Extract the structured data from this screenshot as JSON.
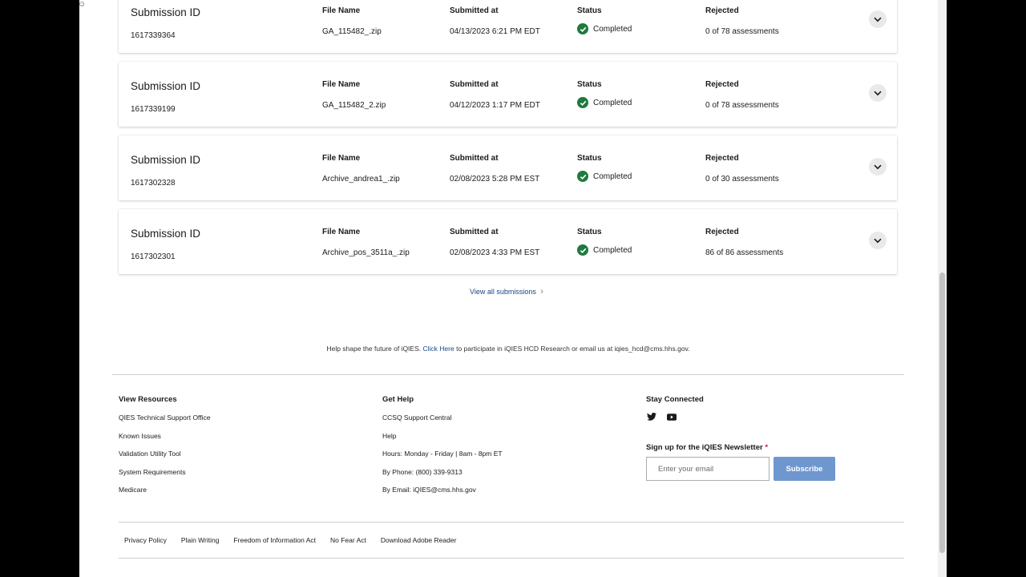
{
  "submissions": [
    {
      "label": "Submission ID",
      "id": "1617339364",
      "file_header": "File Name",
      "file": "GA_115482_.zip",
      "date_header": "Submitted at",
      "date": "04/13/2023 6:21 PM EDT",
      "status_header": "Status",
      "status": "Completed",
      "rejected_header": "Rejected",
      "rejected": "0 of 78 assessments"
    },
    {
      "label": "Submission ID",
      "id": "1617339199",
      "file_header": "File Name",
      "file": "GA_115482_2.zip",
      "date_header": "Submitted at",
      "date": "04/12/2023 1:17 PM EDT",
      "status_header": "Status",
      "status": "Completed",
      "rejected_header": "Rejected",
      "rejected": "0 of 78 assessments"
    },
    {
      "label": "Submission ID",
      "id": "1617302328",
      "file_header": "File Name",
      "file": "Archive_andrea1_.zip",
      "date_header": "Submitted at",
      "date": "02/08/2023 5:28 PM EST",
      "status_header": "Status",
      "status": "Completed",
      "rejected_header": "Rejected",
      "rejected": "0 of 30 assessments"
    },
    {
      "label": "Submission ID",
      "id": "1617302301",
      "file_header": "File Name",
      "file": "Archive_pos_3511a_.zip",
      "date_header": "Submitted at",
      "date": "02/08/2023 4:33 PM EST",
      "status_header": "Status",
      "status": "Completed",
      "rejected_header": "Rejected",
      "rejected": "86 of 86 assessments"
    }
  ],
  "view_all": "View all submissions",
  "help": {
    "before": "Help shape the future of iQIES.",
    "link": "Click Here",
    "after": "to participate in iQIES HCD Research or email us at iqies_hcd@cms.hhs.gov."
  },
  "footer": {
    "resources": {
      "title": "View Resources",
      "items": [
        "QIES Technical Support Office",
        "Known Issues",
        "Validation Utility Tool",
        "System Requirements",
        "Medicare"
      ]
    },
    "get_help": {
      "title": "Get Help",
      "items": [
        "CCSQ Support Central",
        "Help",
        "Hours: Monday - Friday | 8am - 8pm ET",
        "By Phone: (800) 339-9313",
        "By Email: iQIES@cms.hhs.gov"
      ]
    },
    "stay_connected": {
      "title": "Stay Connected",
      "icons": [
        "twitter-icon",
        "youtube-icon"
      ]
    },
    "newsletter": {
      "label": "Sign up for the iQIES Newsletter",
      "required": "*",
      "placeholder": "Enter your email",
      "button": "Subscribe"
    },
    "legal": [
      "Privacy Policy",
      "Plain Writing",
      "Freedom of Information Act",
      "No Fear Act",
      "Download Adobe Reader"
    ]
  },
  "colors": {
    "check": "#1f7a3d",
    "rejected_alert": "#c0235c",
    "link": "#1a4480",
    "subscribe": "#6e97cf"
  }
}
